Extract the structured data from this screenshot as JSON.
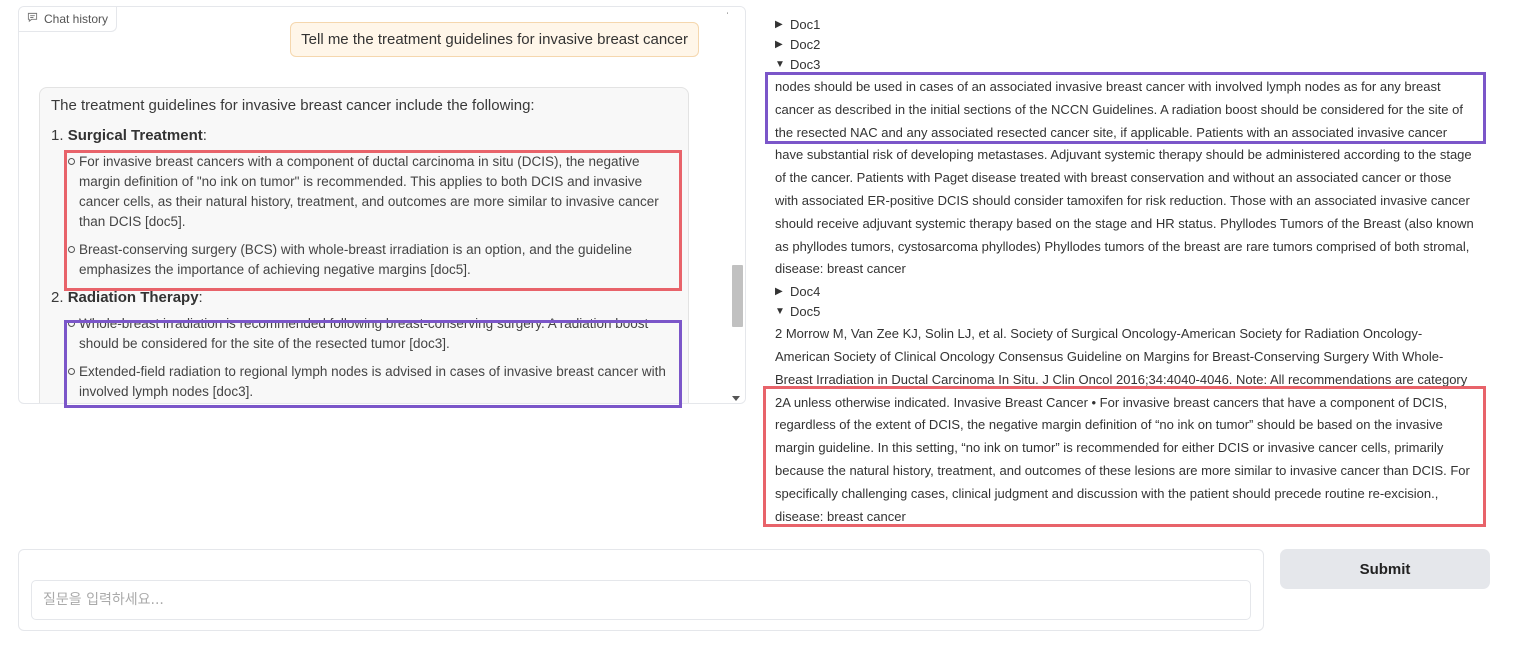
{
  "chat": {
    "label": "Chat history",
    "user_message": "Tell me the treatment guidelines for invasive breast cancer",
    "bot_intro": "The treatment guidelines for invasive breast cancer include the following:",
    "sections": [
      {
        "number": "1.",
        "title": "Surgical Treatment",
        "bullets": [
          "For invasive breast cancers with a component of ductal carcinoma in situ (DCIS), the negative margin definition of \"no ink on tumor\" is recommended. This applies to both DCIS and invasive cancer cells, as their natural history, treatment, and outcomes are more similar to invasive cancer than DCIS [doc5].",
          "Breast-conserving surgery (BCS) with whole-breast irradiation is an option, and the guideline emphasizes the importance of achieving negative margins [doc5]."
        ]
      },
      {
        "number": "2.",
        "title": "Radiation Therapy",
        "bullets": [
          "Whole-breast irradiation is recommended following breast-conserving surgery. A radiation boost should be considered for the site of the resected tumor [doc3].",
          "Extended-field radiation to regional lymph nodes is advised in cases of invasive breast cancer with involved lymph nodes [doc3]."
        ]
      }
    ]
  },
  "docs": [
    {
      "label": "Doc1",
      "open": false
    },
    {
      "label": "Doc2",
      "open": false
    },
    {
      "label": "Doc3",
      "open": true,
      "highlight": "nodes should be used in cases of an associated invasive breast cancer with involved lymph nodes as for any breast cancer as described in the initial sections of the NCCN Guidelines. A radiation boost should be considered for the site of the resected NAC and any associated resected cancer site, if applicable. Patients with an associated invasive cancer have",
      "rest": "substantial risk of developing metastases. Adjuvant systemic therapy should be administered according to the stage of the cancer. Patients with Paget disease treated with breast conservation and without an associated cancer or those with associated ER-positive DCIS should consider tamoxifen for risk reduction. Those with an associated invasive cancer should receive adjuvant systemic therapy based on the stage and HR status. Phyllodes Tumors of the Breast (also known as phyllodes tumors, cystosarcoma phyllodes) Phyllodes tumors of the breast are rare tumors comprised of both stromal, disease: breast cancer"
    },
    {
      "label": "Doc4",
      "open": false
    },
    {
      "label": "Doc5",
      "open": true,
      "intro": "2 Morrow M, Van Zee KJ, Solin LJ, et al. Society of Surgical Oncology-American Society for Radiation Oncology-American Society of Clinical Oncology Consensus Guideline on Margins for Breast-Conserving Surgery With Whole-Breast Irradiation in Ductal Carcinoma In Situ. J Clin Oncol 2016;34:4040-4046. Note: All recommendations are category 2A",
      "highlight": "unless otherwise indicated. Invasive Breast Cancer • For invasive breast cancers that have a component of DCIS, regardless of the extent of DCIS, the negative margin definition of “no ink on tumor” should be based on the invasive margin guideline. In this setting, “no ink on tumor” is recommended for either DCIS or invasive cancer cells, primarily because the natural history, treatment, and outcomes of these lesions are more similar to invasive cancer than DCIS. For specifically challenging cases, clinical judgment and discussion with the patient should precede routine re-excision., disease: breast cancer"
    }
  ],
  "input": {
    "placeholder": "질문을 입력하세요..."
  },
  "submit_label": "Submit",
  "colors": {
    "highlight_red": "#e8636a",
    "highlight_purple": "#7b56c9",
    "user_bubble": "#fff6e9"
  }
}
